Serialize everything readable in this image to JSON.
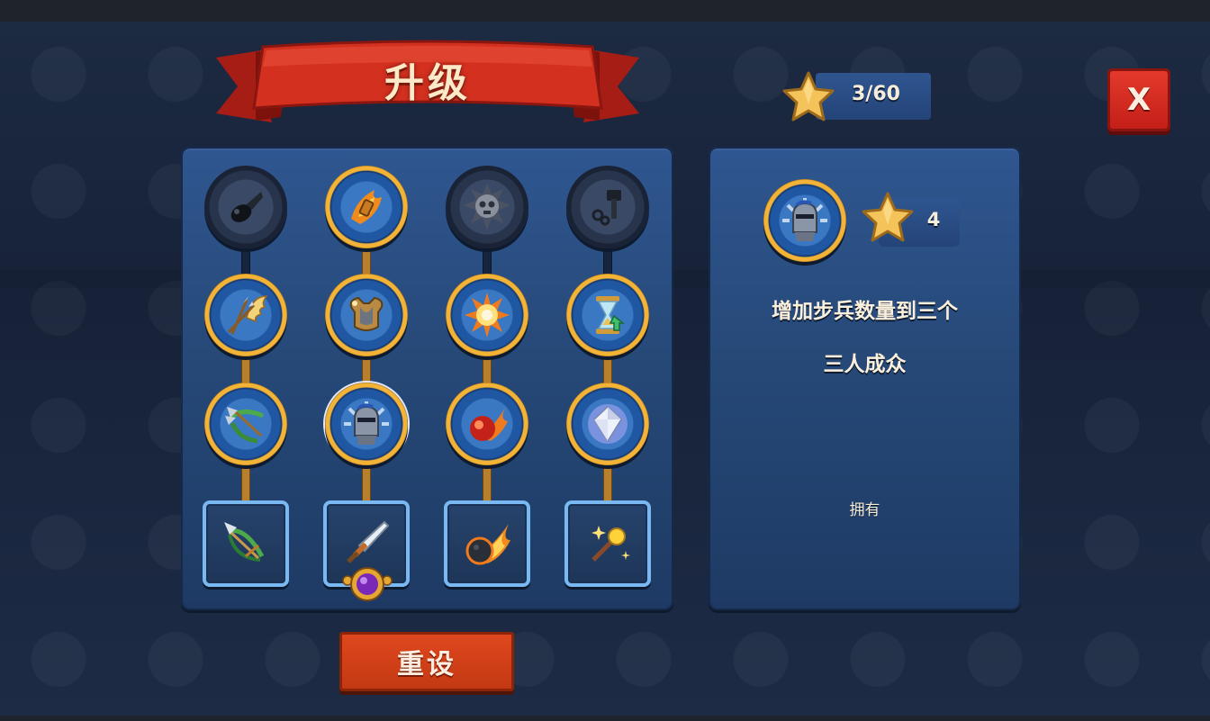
{
  "header": {
    "title": "升级",
    "stars_count": "3/60",
    "close_label": "X"
  },
  "upgrade_tree": {
    "columns": [
      {
        "name": "archer",
        "nodes": [
          {
            "icon": "bomb-icon",
            "state": "locked"
          },
          {
            "icon": "winged-arrows-icon",
            "state": "unlocked"
          },
          {
            "icon": "crossbow-arrows-icon",
            "state": "unlocked"
          }
        ],
        "item": {
          "icon": "bow-icon"
        }
      },
      {
        "name": "barracks",
        "nodes": [
          {
            "icon": "flaming-shield-icon",
            "state": "unlocked"
          },
          {
            "icon": "armor-icon",
            "state": "unlocked"
          },
          {
            "icon": "knight-helmet-icon",
            "state": "unlocked",
            "selected": true
          }
        ],
        "item": {
          "icon": "sword-icon"
        }
      },
      {
        "name": "artillery",
        "nodes": [
          {
            "icon": "spiked-skull-bomb-icon",
            "state": "locked"
          },
          {
            "icon": "explosion-icon",
            "state": "unlocked"
          },
          {
            "icon": "fireball-icon",
            "state": "unlocked"
          }
        ],
        "item": {
          "icon": "meteor-icon"
        }
      },
      {
        "name": "mage",
        "nodes": [
          {
            "icon": "hammer-icon",
            "state": "locked"
          },
          {
            "icon": "hourglass-icon",
            "state": "unlocked"
          },
          {
            "icon": "crystal-icon",
            "state": "unlocked"
          }
        ],
        "item": {
          "icon": "magic-wand-icon"
        }
      }
    ]
  },
  "detail": {
    "icon": "knight-helmet-icon",
    "cost": "4",
    "description": "增加步兵数量到三个",
    "name": "三人成众",
    "status": "拥有"
  },
  "footer": {
    "reset_label": "重设"
  },
  "colors": {
    "panel_blue": "#2a4f86",
    "gold": "#f2b336",
    "ribbon_red": "#c8281c",
    "button_red": "#d9401b",
    "item_border": "#79b8f0"
  }
}
